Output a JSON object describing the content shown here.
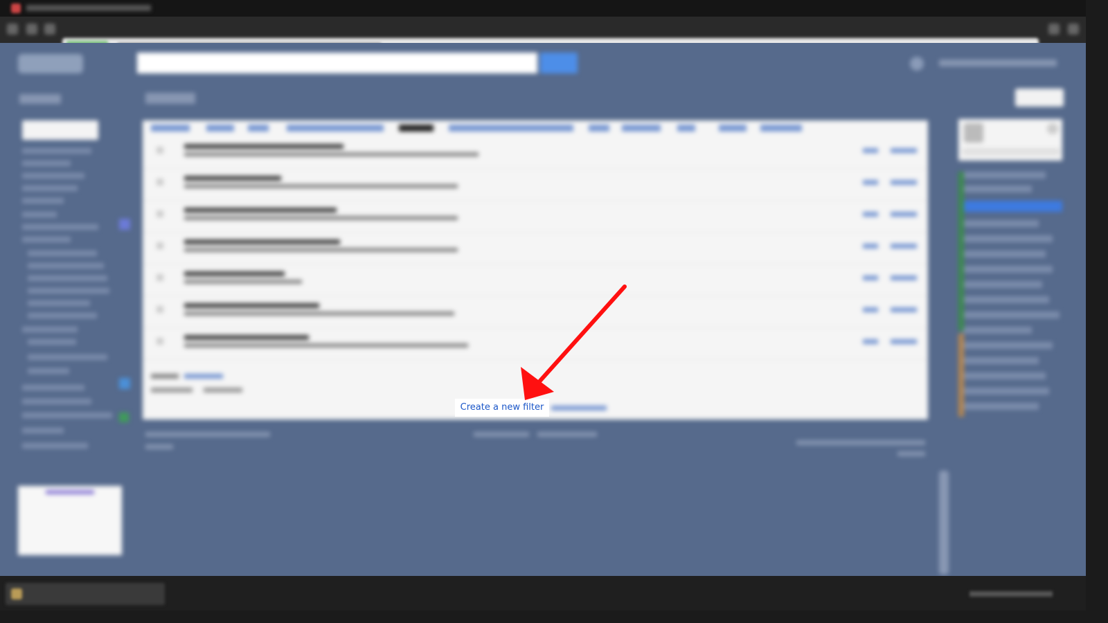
{
  "highlight": {
    "link_label": "Create a new filter",
    "link_color": "#1a56c8",
    "arrow_color": "#ff1010"
  },
  "theme": {
    "page_background": "#566a8c",
    "content_background": "#f5f5f5",
    "accent_blue": "#4d8ee8"
  },
  "icons": {
    "search_button": "search-icon",
    "settings": "gear-icon",
    "annotation": "arrow-icon"
  }
}
